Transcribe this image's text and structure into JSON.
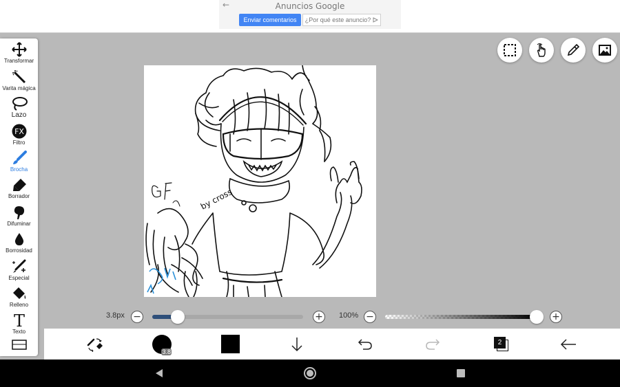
{
  "ad": {
    "back_icon": "arrow-left-icon",
    "title": "Anuncios Google",
    "feedback_label": "Enviar comentarios",
    "why_label": "¿Por qué este anuncio?",
    "why_icon": "adchoices-icon"
  },
  "tools": [
    {
      "label": "Transformar",
      "icon": "move-arrows-icon"
    },
    {
      "label": "Varita mágica",
      "icon": "magic-wand-icon"
    },
    {
      "label": "Lazo",
      "icon": "lasso-icon"
    },
    {
      "label": "Filtro",
      "icon": "fx-icon"
    },
    {
      "label": "Brocha",
      "icon": "brush-icon",
      "active": true
    },
    {
      "label": "Borrador",
      "icon": "eraser-icon"
    },
    {
      "label": "Difuminar",
      "icon": "smudge-icon"
    },
    {
      "label": "Borrosidad",
      "icon": "blur-drop-icon"
    },
    {
      "label": "Especial",
      "icon": "special-brush-icon"
    },
    {
      "label": "Relleno",
      "icon": "fill-bucket-icon"
    },
    {
      "label": "Texto",
      "icon": "text-icon"
    },
    {
      "label": "",
      "icon": "frame-icon"
    }
  ],
  "top_buttons": [
    "selection-icon",
    "hand-gesture-icon",
    "eyedropper-icon",
    "image-icon"
  ],
  "canvas": {
    "signature_text": "by cross",
    "letters": "GF"
  },
  "brush_size": {
    "value_label": "3.8px",
    "fraction": 0.17,
    "minus": "−",
    "plus": "+"
  },
  "opacity": {
    "value_label": "100%",
    "fraction": 1.0,
    "minus": "−",
    "plus": "+"
  },
  "bottom": {
    "brush_size_badge": "3.8",
    "layer_count": "2",
    "icons": [
      "swap-brush-eraser-icon",
      "brush-size-icon",
      "color-swatch-icon",
      "download-arrow-icon",
      "undo-icon",
      "redo-icon",
      "layers-icon",
      "back-arrow-icon"
    ]
  },
  "colors": {
    "accent": "#2d7de0",
    "slider_fill": "#2e4f7a",
    "slider_track": "#a8a8a8",
    "workspace": "#b9b9b9",
    "primary_color": "#000000"
  }
}
